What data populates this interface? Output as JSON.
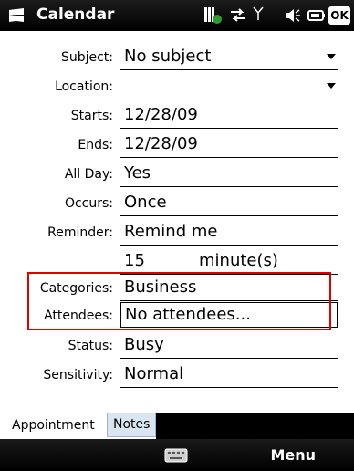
{
  "titlebar": {
    "app_title": "Calendar",
    "ok_label": "OK",
    "icons": [
      "windows-start-icon",
      "signal-data-icon",
      "sync-arrows-icon",
      "antenna-icon",
      "volume-icon",
      "battery-icon"
    ]
  },
  "form": {
    "subject": {
      "label": "Subject:",
      "value": "No subject"
    },
    "location": {
      "label": "Location:",
      "value": ""
    },
    "starts": {
      "label": "Starts:",
      "value": "12/28/09"
    },
    "ends": {
      "label": "Ends:",
      "value": "12/28/09"
    },
    "all_day": {
      "label": "All Day:",
      "value": "Yes"
    },
    "occurs": {
      "label": "Occurs:",
      "value": "Once"
    },
    "reminder": {
      "label": "Reminder:",
      "value": "Remind me",
      "amount": "15",
      "unit": "minute(s)"
    },
    "categories": {
      "label": "Categories:",
      "value": "Business"
    },
    "attendees": {
      "label": "Attendees:",
      "value": "No attendees..."
    },
    "status": {
      "label": "Status:",
      "value": "Busy"
    },
    "sensitivity": {
      "label": "Sensitivity:",
      "value": "Normal"
    }
  },
  "tabs": [
    {
      "label": "Appointment",
      "active": true
    },
    {
      "label": "Notes",
      "active": false
    }
  ],
  "softkeys": {
    "right_label": "Menu"
  },
  "colors": {
    "highlight": "#e00000",
    "notes_tab": "#d9e6f2"
  }
}
